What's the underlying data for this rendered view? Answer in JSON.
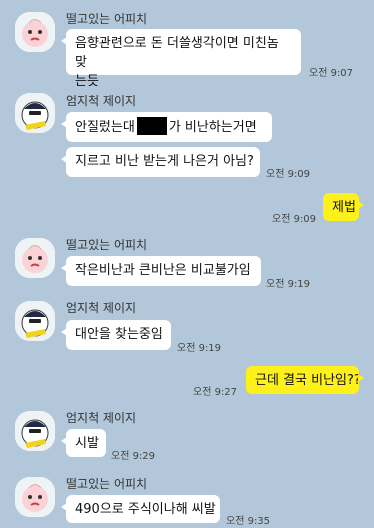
{
  "colors": {
    "background": "#b2c7d9",
    "incoming_bubble": "#ffffff",
    "outgoing_bubble": "#fef01b"
  },
  "users": {
    "peach": "떨고있는 어피치",
    "jay": "엄지척 제이지"
  },
  "messages": {
    "m1": {
      "sender": "떨고있는 어피치",
      "line1": "음향관련으로 돈 더쓸생각이면 미친놈 맞",
      "line2": "는듯",
      "time": "오전 9:07"
    },
    "m2": {
      "sender": "엄지척 제이지",
      "pre": "안질렀는대",
      "post": "가 비난하는거면",
      "redacted": true
    },
    "m3": {
      "text": "지르고 비난 받는게 나은거 아님?",
      "time": "오전 9:09"
    },
    "m4": {
      "text": "제법",
      "time": "오전 9:09"
    },
    "m5": {
      "sender": "떨고있는 어피치",
      "text": "작은비난과 큰비난은 비교불가임",
      "time": "오전 9:19"
    },
    "m6": {
      "sender": "엄지척 제이지",
      "text": "대안을 찾는중임",
      "time": "오전 9:19"
    },
    "m7": {
      "text": "근데 결국 비난임??",
      "time": "오전 9:27"
    },
    "m8": {
      "sender": "엄지척 제이지",
      "text": "시발",
      "time": "오전 9:29"
    },
    "m9": {
      "sender": "떨고있는 어피치",
      "text": "490으로 주식이나해 씨발",
      "time": "오전 9:35"
    }
  }
}
